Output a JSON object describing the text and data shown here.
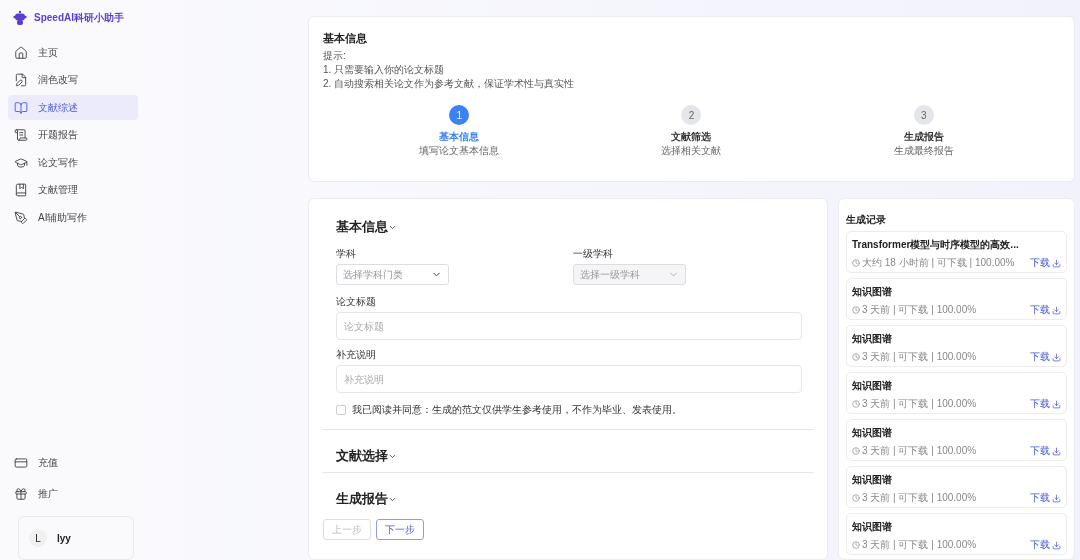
{
  "brand": "SpeedAI科研小助手",
  "nav": [
    {
      "label": "主页",
      "selected": false
    },
    {
      "label": "润色改写",
      "selected": false
    },
    {
      "label": "文献综述",
      "selected": true
    },
    {
      "label": "开题报告",
      "selected": false
    },
    {
      "label": "论文写作",
      "selected": false
    },
    {
      "label": "文献管理",
      "selected": false
    },
    {
      "label": "AI辅助写作",
      "selected": false
    }
  ],
  "nav_bottom": [
    {
      "label": "充值"
    },
    {
      "label": "推广"
    }
  ],
  "user": {
    "initial": "L",
    "name": "lyy"
  },
  "intro": {
    "title": "基本信息",
    "lines": [
      "提示:",
      "1. 只需要输入你的论文标题",
      "2. 自动搜索相关论文作为参考文献，保证学术性与真实性"
    ]
  },
  "steps": [
    {
      "number": "1",
      "title": "基本信息",
      "subtitle": "填写论文基本信息",
      "selected": true
    },
    {
      "number": "2",
      "title": "文献筛选",
      "subtitle": "选择相关文献",
      "selected": false
    },
    {
      "number": "3",
      "title": "生成报告",
      "subtitle": "生成最终报告",
      "selected": false
    }
  ],
  "sections": [
    {
      "title": "基本信息",
      "kind": "form"
    },
    {
      "title": "文献选择",
      "kind": "header"
    },
    {
      "title": "生成报告",
      "kind": "header"
    }
  ],
  "form": {
    "selects": [
      {
        "label": "学科",
        "placeholder": "选择学科门类",
        "disabled": false
      },
      {
        "label": "一级学科",
        "placeholder": "选择一级学科",
        "disabled": true
      }
    ],
    "inputs": [
      {
        "label": "论文标题",
        "placeholder": "论文标题"
      },
      {
        "label": "补充说明",
        "placeholder": "补充说明"
      }
    ],
    "agreement": {
      "text": "我已阅读并同意：生成的范文仅供学生参考使用，不作为毕业、发表使用。",
      "checked": false
    }
  },
  "buttons": [
    {
      "label": "上一步",
      "disabled": true
    },
    {
      "label": "下一步",
      "disabled": false
    }
  ],
  "records": {
    "title": "生成记录",
    "items": [
      {
        "title": "Transformer模型与时序模型的高效...",
        "meta": "大约 18 小时前 | 可下载 | 100.00%",
        "action": "下载"
      },
      {
        "title": "知识图谱",
        "meta": "3 天前 | 可下载 | 100.00%",
        "action": "下载"
      },
      {
        "title": "知识图谱",
        "meta": "3 天前 | 可下载 | 100.00%",
        "action": "下载"
      },
      {
        "title": "知识图谱",
        "meta": "3 天前 | 可下载 | 100.00%",
        "action": "下载"
      },
      {
        "title": "知识图谱",
        "meta": "3 天前 | 可下载 | 100.00%",
        "action": "下载"
      },
      {
        "title": "知识图谱",
        "meta": "3 天前 | 可下载 | 100.00%",
        "action": "下载"
      },
      {
        "title": "知识图谱",
        "meta": "3 天前 | 可下载 | 100.00%",
        "action": "下载"
      }
    ]
  }
}
